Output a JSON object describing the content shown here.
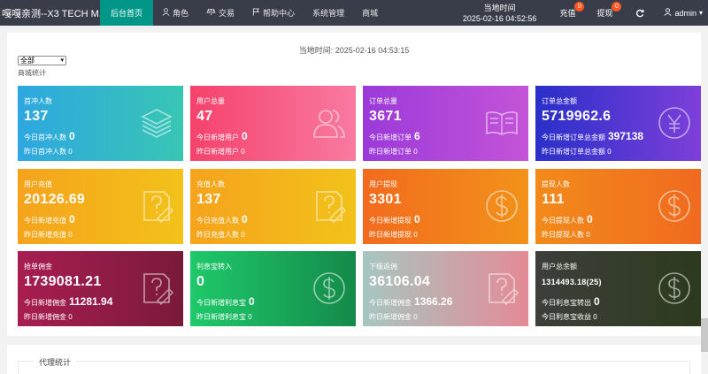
{
  "brand": "嘎嘎亲测--X3 TECH M...",
  "nav": [
    {
      "label": "后台首页",
      "icon": ""
    },
    {
      "label": "角色",
      "icon": "user-icon"
    },
    {
      "label": "交易",
      "icon": "scale-icon"
    },
    {
      "label": "帮助中心",
      "icon": "flag-icon"
    },
    {
      "label": "系统管理",
      "icon": ""
    },
    {
      "label": "商城",
      "icon": ""
    }
  ],
  "clock": {
    "label": "当地时间",
    "time": "2025-02-16 04:52:56"
  },
  "recharge": {
    "label": "充值",
    "badge": "0"
  },
  "withdraw": {
    "label": "提现",
    "badge": "0"
  },
  "user": {
    "name": "admin",
    "caret": "▾"
  },
  "local_time": "当地时间:  2025-02-16 04:53:15",
  "filter": {
    "selected": "全部"
  },
  "section_label": "商城统计",
  "cards": [
    {
      "title": "首冲人数",
      "value": "137",
      "l1_label": "今日首冲人数",
      "l1_value": "0",
      "l2": "昨日首冲人数 0",
      "icon": "layers-icon",
      "color_from": "#2ea7e0",
      "color_to": "#38c6b4"
    },
    {
      "title": "用户总量",
      "value": "47",
      "l1_label": "今日新增用户",
      "l1_value": "0",
      "l2": "昨日新增用户 0",
      "icon": "users-icon",
      "color_from": "#f5426c",
      "color_to": "#f87aa0"
    },
    {
      "title": "订单总量",
      "value": "3671",
      "l1_label": "今日新增订单",
      "l1_value": "6",
      "l2": "昨日新增订单 0",
      "icon": "book-icon",
      "color_from": "#9b3ad9",
      "color_to": "#c454d8"
    },
    {
      "title": "订单总金额",
      "value": "5719962.6",
      "l1_label": "今日新增订单总金额",
      "l1_value": "397138",
      "l2": "昨日新增订单总金额 0",
      "icon": "yen-icon",
      "color_from": "#2a2fc9",
      "color_to": "#7e3fd9"
    },
    {
      "title": "用户充值",
      "value": "20126.69",
      "l1_label": "今日新增充值",
      "l1_value": "0",
      "l2": "昨日新增充值 0",
      "icon": "question-icon",
      "color_from": "#f5a31c",
      "color_to": "#f2c21a"
    },
    {
      "title": "充值人数",
      "value": "137",
      "l1_label": "今日充值人数",
      "l1_value": "0",
      "l2": "昨日充值人数 0",
      "icon": "question-icon",
      "color_from": "#f5a31c",
      "color_to": "#f2c21a"
    },
    {
      "title": "用户提现",
      "value": "3301",
      "l1_label": "今日新增提现",
      "l1_value": "0",
      "l2": "昨日新增提现 0",
      "icon": "dollar-icon",
      "color_from": "#f26b1d",
      "color_to": "#f2921a"
    },
    {
      "title": "提现人数",
      "value": "111",
      "l1_label": "今日提现人数",
      "l1_value": "0",
      "l2": "昨日提现人数 0",
      "icon": "dollar-icon",
      "color_from": "#f28a1a",
      "color_to": "#f06a1f"
    },
    {
      "title": "抢单佣金",
      "value": "1739081.21",
      "l1_label": "今日新增佣金",
      "l1_value": "11281.94",
      "l2": "昨日新增佣金 0",
      "icon": "question-icon",
      "color_from": "#a81d52",
      "color_to": "#7a1a3a"
    },
    {
      "title": "利息宝转入",
      "value": "0",
      "l1_label": "今日新增利息宝",
      "l1_value": "0",
      "l2": "昨日新增利息宝 0",
      "icon": "dollar-icon",
      "color_from": "#1fc96a",
      "color_to": "#148a4a"
    },
    {
      "title": "下级返佣",
      "value": "36106.04",
      "l1_label": "今日新增佣金",
      "l1_value": "1366.26",
      "l2": "昨日新增佣金 0",
      "icon": "question-icon",
      "color_from": "#a7c6c0",
      "color_to": "#e48a96"
    },
    {
      "title": "用户总余额",
      "value": "1314493.18(25)",
      "l1_label": "今日利息宝转出",
      "l1_value": "0",
      "l2": "今日利息宝收益 0",
      "icon": "dollar-icon",
      "color_from": "#3c3f3a",
      "color_to": "#2d3a1e",
      "small_value": true
    }
  ],
  "agent_stats": "代理统计"
}
